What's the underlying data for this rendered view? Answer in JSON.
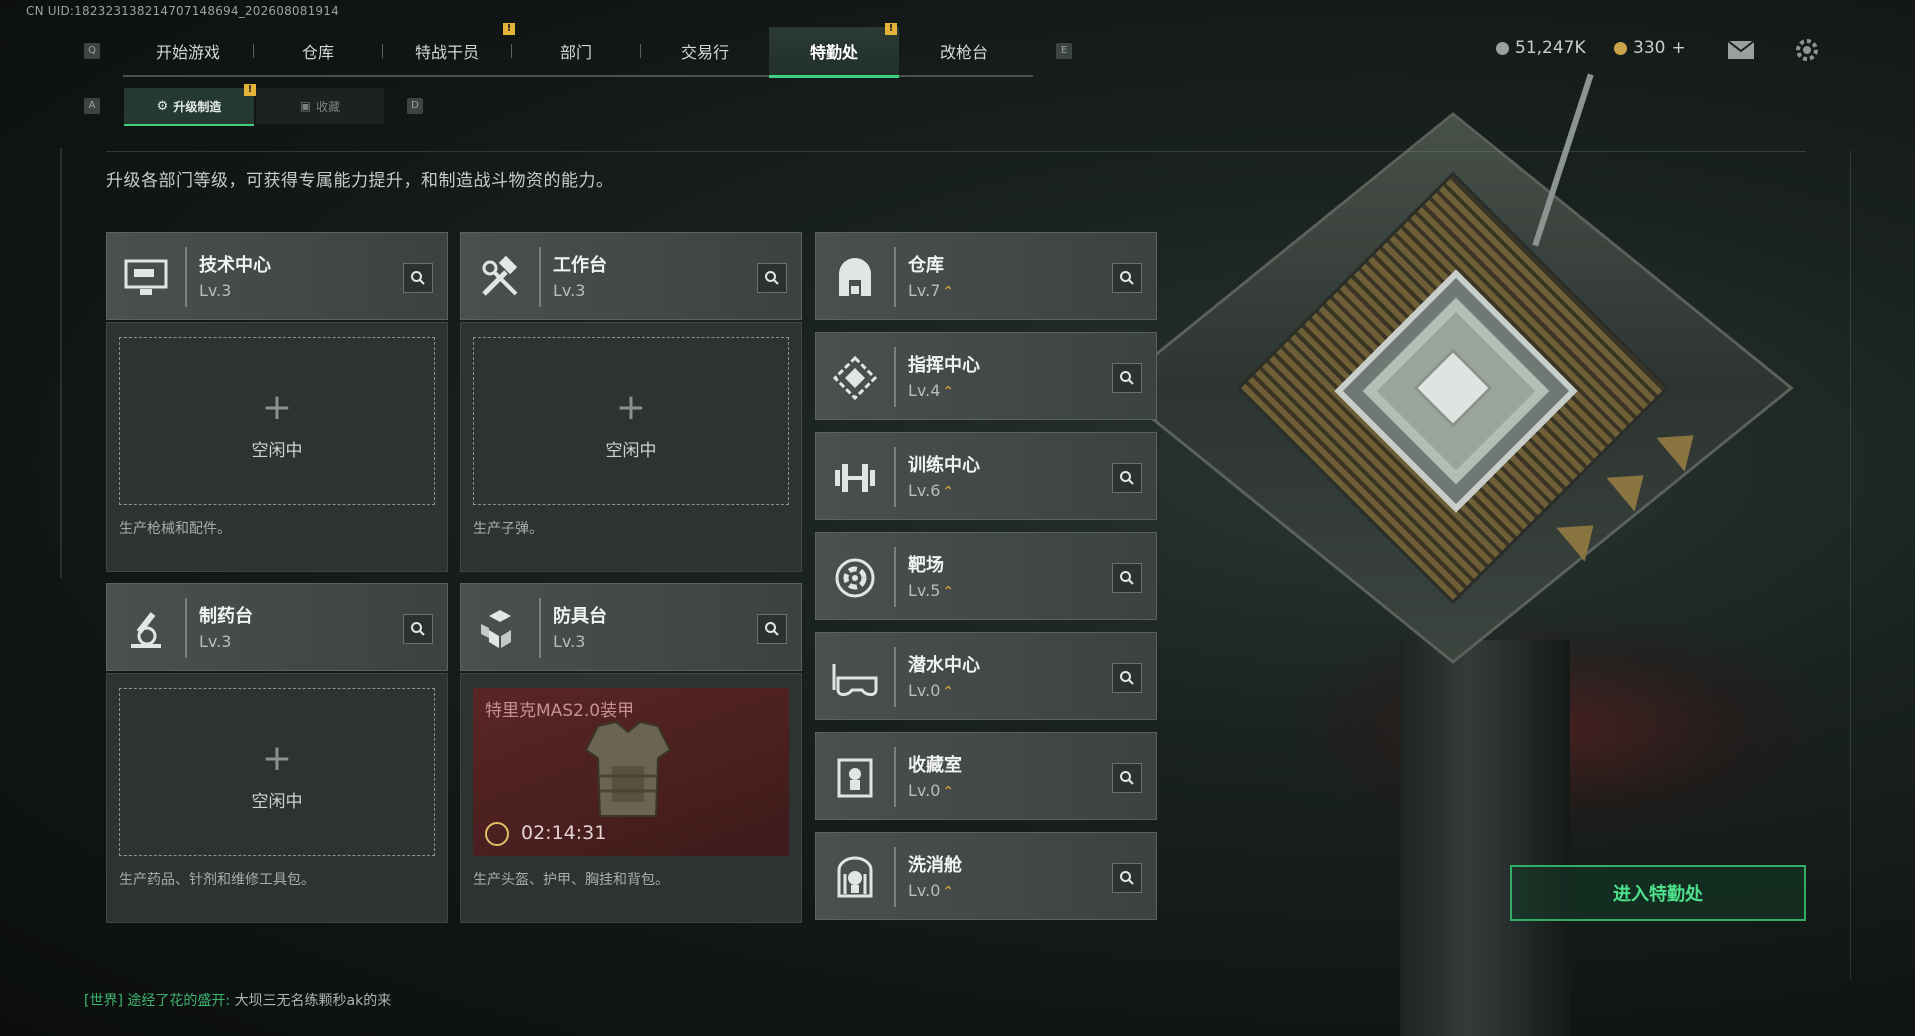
{
  "uid": "CN UID:18232313821470714869​4_202608081914",
  "topnav": {
    "left_key": "Q",
    "right_key": "E",
    "tabs": [
      {
        "label": "开始游戏"
      },
      {
        "label": "仓库"
      },
      {
        "label": "特战干员"
      },
      {
        "label": "部门"
      },
      {
        "label": "交易行"
      },
      {
        "label": "特勤处"
      },
      {
        "label": "改枪台"
      }
    ],
    "warning_mark": "!"
  },
  "currency": {
    "coins": "51,247K",
    "premium": "330",
    "add": "+"
  },
  "subnav": {
    "left_key": "A",
    "right_key": "D",
    "tabs": [
      {
        "label": "升级制造"
      },
      {
        "label": "收藏"
      }
    ]
  },
  "description": "升级各部门等级，可获得专属能力提升，和制造战斗物资的能力。",
  "production": [
    {
      "name": "技术中心",
      "level": "Lv.3",
      "status": "空闲中",
      "plus": "+",
      "desc": "生产枪械和配件。"
    },
    {
      "name": "工作台",
      "level": "Lv.3",
      "status": "空闲中",
      "plus": "+",
      "desc": "生产子弹。"
    },
    {
      "name": "制药台",
      "level": "Lv.3",
      "status": "空闲中",
      "plus": "+",
      "desc": "生产药品、针剂和维修工具包。"
    },
    {
      "name": "防具台",
      "level": "Lv.3",
      "item": "特里克MAS2.0装甲",
      "timer": "02:14:31",
      "desc": "生产头盔、护甲、胸挂和背包。"
    }
  ],
  "facilities": [
    {
      "name": "仓库",
      "level": "Lv.7",
      "upgrade": "⌃"
    },
    {
      "name": "指挥中心",
      "level": "Lv.4",
      "upgrade": "⌃"
    },
    {
      "name": "训练中心",
      "level": "Lv.6",
      "upgrade": "⌃"
    },
    {
      "name": "靶场",
      "level": "Lv.5",
      "upgrade": "⌃"
    },
    {
      "name": "潜水中心",
      "level": "Lv.0",
      "upgrade": "⌃"
    },
    {
      "name": "收藏室",
      "level": "Lv.0",
      "upgrade": "⌃"
    },
    {
      "name": "洗消舱",
      "level": "Lv.0",
      "upgrade": "⌃"
    }
  ],
  "enter_button": "进入特勤处",
  "chat": {
    "channel": "[世界]",
    "user": "途经了花的盛开:",
    "message": "大坝三无名练颗秒ak的来"
  },
  "colors": {
    "accent": "#3fcf7f",
    "warning": "#e3b33a",
    "upgrade": "#d9a73c"
  }
}
